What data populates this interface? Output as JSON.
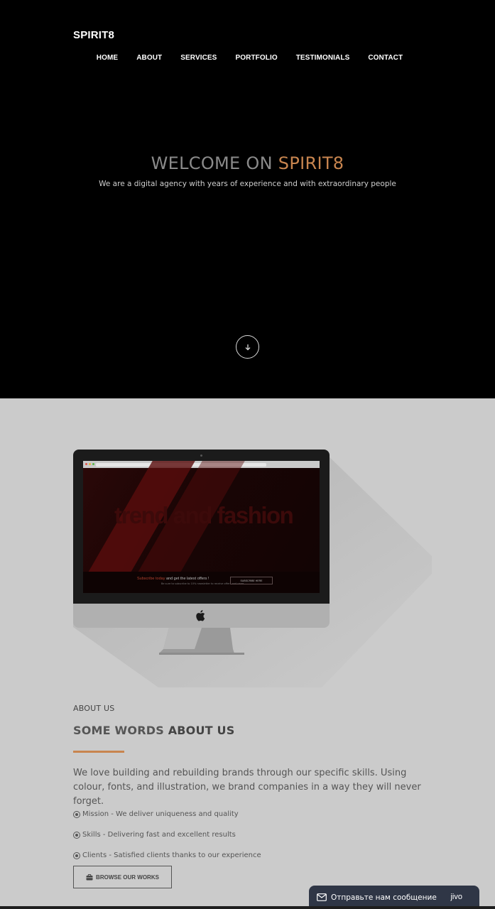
{
  "header": {
    "brand": "SPIRIT8",
    "nav": [
      "HOME",
      "ABOUT",
      "SERVICES",
      "PORTFOLIO",
      "TESTIMONIALS",
      "CONTACT"
    ]
  },
  "hero": {
    "title_prefix": "WELCOME ON ",
    "title_accent": "SPIRIT8",
    "tagline": "We are a digital agency with years of experience and with extraordinary people",
    "scroll_icon": "arrow-down-icon"
  },
  "mockup": {
    "screen_title": "trend and fashion",
    "promo_highlight": "Subscribe today",
    "promo_rest": " and get the latest offers !",
    "promo_sub": "Be sure to subscribe to 10% newsletter to receive offers and news",
    "subscribe_button": "SUBSCRIBE HERE"
  },
  "about": {
    "label": "ABOUT US",
    "title_light": "SOME WORDS ",
    "title_bold": "ABOUT US",
    "text": "We love building and rebuilding brands through our specific skills. Using colour, fonts, and illustration, we brand companies in a way they will never forget.",
    "bullets": [
      "Mission - We deliver uniqueness and quality",
      "Skills - Delivering fast and excellent results",
      "Clients - Satisfied clients thanks to our experience"
    ],
    "button_label": "BROWSE OUR WORKS"
  },
  "chat": {
    "label": "Отправьте нам сообщение",
    "brand": "jivo"
  },
  "colors": {
    "accent": "#c8854f",
    "hero_bg": "#000000",
    "about_bg": "#cbcbcb",
    "chat_bg": "#2f3646"
  }
}
